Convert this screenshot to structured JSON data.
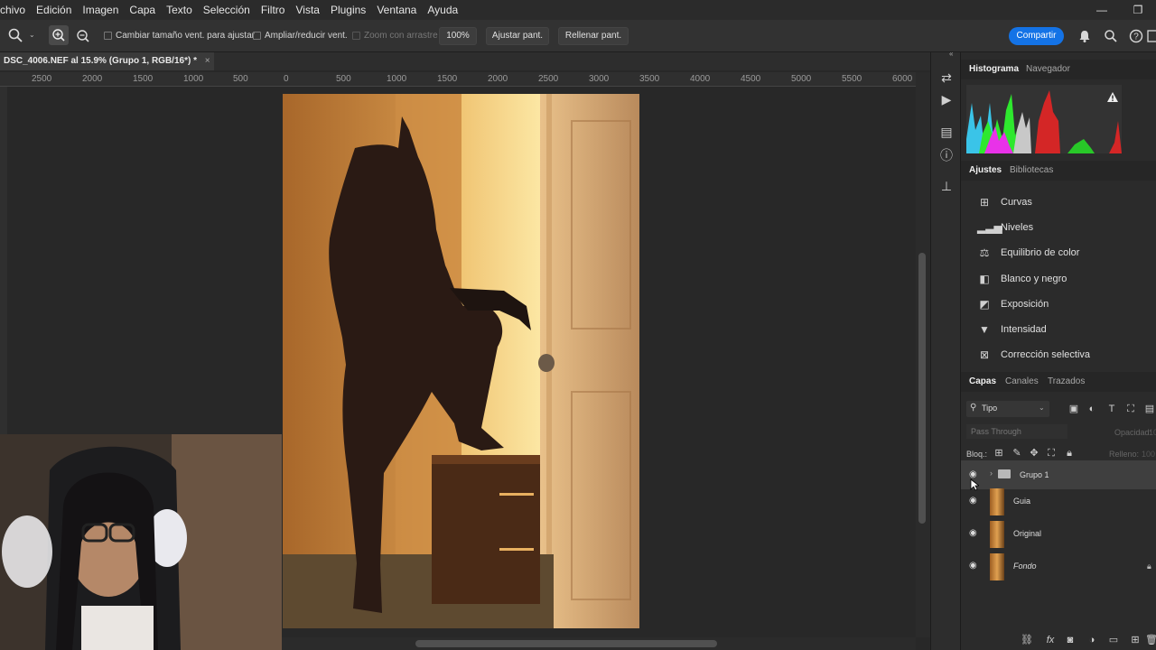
{
  "menu": [
    "chivo",
    "Edición",
    "Imagen",
    "Capa",
    "Texto",
    "Selección",
    "Filtro",
    "Vista",
    "Plugins",
    "Ventana",
    "Ayuda"
  ],
  "window_controls": {
    "minimize": "—",
    "restore": "❐"
  },
  "options_bar": {
    "check1": "Cambiar tamaño vent. para ajustar",
    "check2": "Ampliar/reducir vent.",
    "check3": "Zoom con arrastre",
    "zoom_value": "100%",
    "fit_screen": "Ajustar pant.",
    "fill_screen": "Rellenar pant.",
    "share": "Compartir"
  },
  "document_tab": {
    "title": "DSC_4006.NEF al 15.9% (Grupo 1, RGB/16*) *",
    "close": "×"
  },
  "ruler_ticks": [
    "2500",
    "2000",
    "1500",
    "1000",
    "500",
    "0",
    "500",
    "1000",
    "1500",
    "2000",
    "2500",
    "3000",
    "3500",
    "4000",
    "4500",
    "5000",
    "5500",
    "6000"
  ],
  "histogram_panel": {
    "tab_active": "Histograma",
    "tab_other": "Navegador"
  },
  "adjustments_panel": {
    "tab_active": "Ajustes",
    "tab_other": "Bibliotecas",
    "items": [
      {
        "label": "Curvas",
        "icon": "curves-icon"
      },
      {
        "label": "Niveles",
        "icon": "levels-icon"
      },
      {
        "label": "Equilibrio de color",
        "icon": "color-balance-icon"
      },
      {
        "label": "Blanco y negro",
        "icon": "black-white-icon"
      },
      {
        "label": "Exposición",
        "icon": "exposure-icon"
      },
      {
        "label": "Intensidad",
        "icon": "vibrance-icon"
      },
      {
        "label": "Corrección selectiva",
        "icon": "selective-color-icon"
      }
    ]
  },
  "layers_panel": {
    "tab_active": "Capas",
    "tab_channels": "Canales",
    "tab_paths": "Trazados",
    "filter_label": "Tipo",
    "blend_mode": "Pass Through",
    "opacity_label": "Opacidad:",
    "opacity_value": "100",
    "lock_label": "Bloq.:",
    "fill_label": "Relleno:",
    "fill_value": "100",
    "layers": [
      {
        "name": "Grupo 1",
        "type": "group",
        "visible": true
      },
      {
        "name": "Guia",
        "type": "pixel",
        "visible": true
      },
      {
        "name": "Original",
        "type": "pixel",
        "visible": true
      },
      {
        "name": "Fondo",
        "type": "background",
        "visible": true
      }
    ]
  },
  "colors": {
    "accent": "#1473e6",
    "panel_bg": "#2b2b2b",
    "canvas_bg": "#282828"
  }
}
